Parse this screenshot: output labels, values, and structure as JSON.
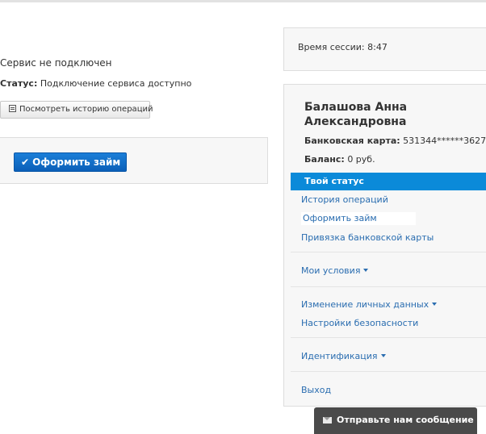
{
  "service": {
    "not_connected": "Сервис не подключен",
    "status_label": "Статус:",
    "status_value": "Подключение сервиса доступно",
    "history_button": "Посмотреть историю операций",
    "loan_button": "Оформить займ"
  },
  "session": {
    "label": "Время сессии:",
    "time": "8:47"
  },
  "profile": {
    "name": "Балашова Анна Александровна",
    "card_label": "Банковская карта:",
    "card_number": "531344******3627",
    "balance_label": "Баланс:",
    "balance_value": "0 руб."
  },
  "nav": {
    "active": "Твой статус",
    "items": [
      "История операций",
      "Оформить займ",
      "Привязка банковской карты",
      "Мои условия",
      "Изменение личных данных",
      "Настройки безопасности",
      "Идентификация",
      "Выход"
    ]
  },
  "footer": {
    "message_button": "Отправьте нам сообщение"
  },
  "colors": {
    "accent": "#0b8ad9",
    "link": "#2a6db0",
    "primary_button": "#0b5fb8",
    "panel_bg": "#f7f7f7"
  }
}
